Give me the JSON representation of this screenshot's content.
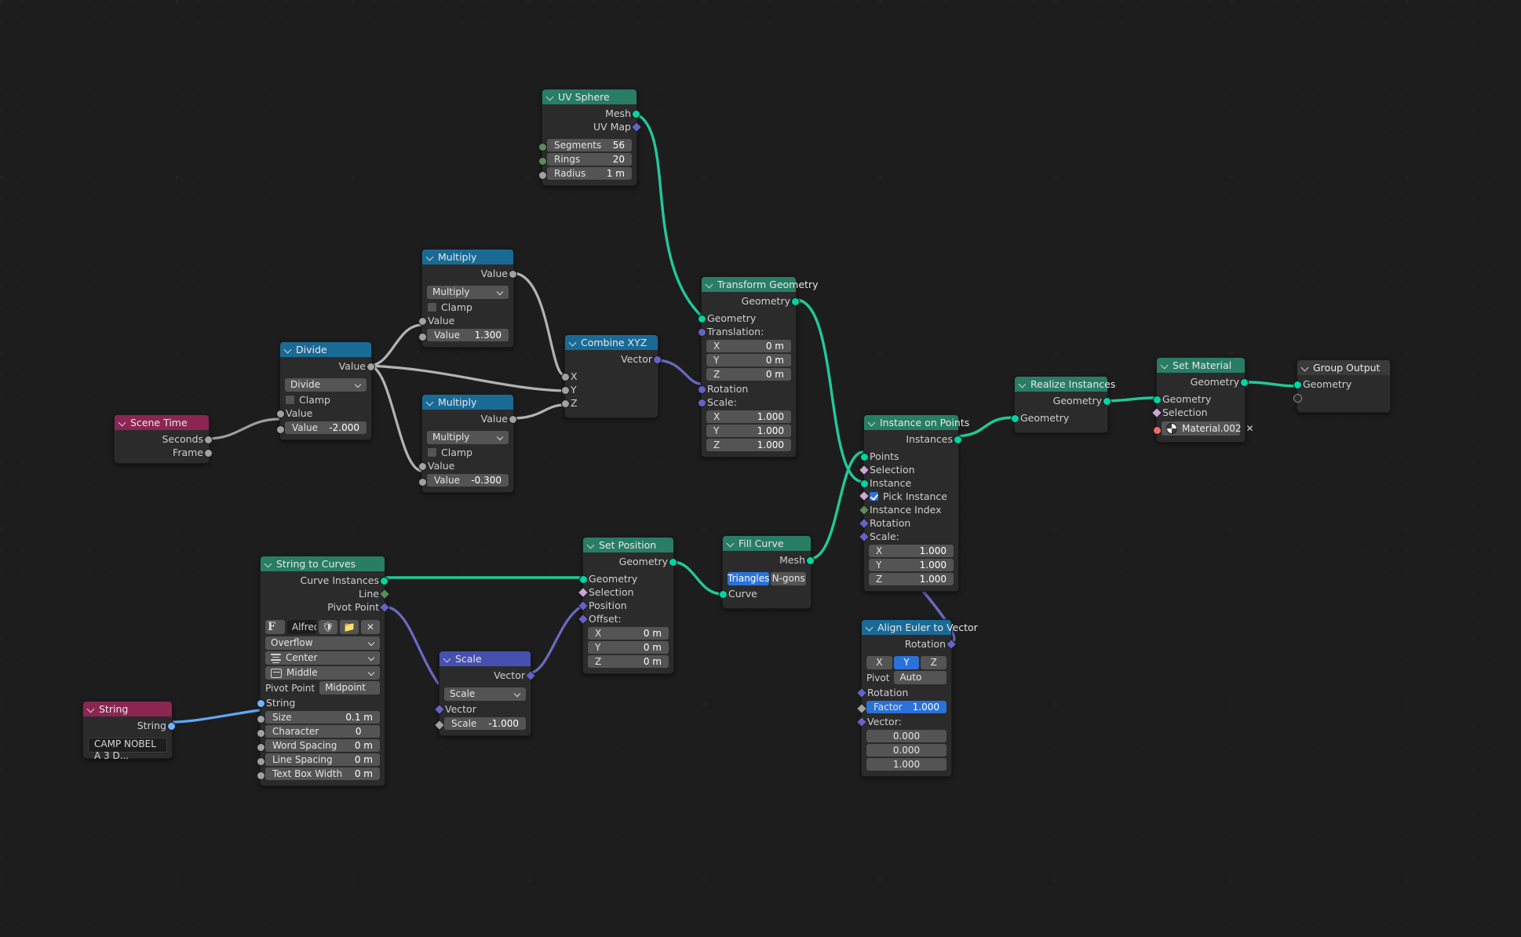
{
  "app": {
    "editor": "Blender Geometry Nodes Editor",
    "background": "#1d1d1d"
  },
  "socket_colors": {
    "geometry": "#00d6a3",
    "vector": "#6363c7",
    "float": "#a1a1a1",
    "integer": "#598c5c",
    "boolean": "#cca6d6",
    "string": "#70b2ff",
    "material": "#ec6a6a"
  },
  "header_colors": {
    "geometry": "#287d63",
    "converter": "#1a6a96",
    "vector": "#4650b0",
    "input": "#8b2653"
  },
  "nodes": {
    "uv_sphere": {
      "title": "UV Sphere",
      "outputs": [
        "Mesh",
        "UV Map"
      ],
      "fields": [
        {
          "label": "Segments",
          "value": "56"
        },
        {
          "label": "Rings",
          "value": "20"
        },
        {
          "label": "Radius",
          "value": "1 m"
        }
      ]
    },
    "multiply_top": {
      "title": "Multiply",
      "output": "Value",
      "operation": "Multiply",
      "clamp_label": "Clamp",
      "clamp_checked": false,
      "input_label": "Value",
      "field": {
        "label": "Value",
        "value": "1.300"
      }
    },
    "multiply_bottom": {
      "title": "Multiply",
      "output": "Value",
      "operation": "Multiply",
      "clamp_label": "Clamp",
      "clamp_checked": false,
      "input_label": "Value",
      "field": {
        "label": "Value",
        "value": "-0.300"
      }
    },
    "divide": {
      "title": "Divide",
      "output": "Value",
      "operation": "Divide",
      "clamp_label": "Clamp",
      "clamp_checked": false,
      "input_label": "Value",
      "field": {
        "label": "Value",
        "value": "-2.000"
      }
    },
    "scene_time": {
      "title": "Scene Time",
      "outputs": [
        "Seconds",
        "Frame"
      ]
    },
    "combine_xyz": {
      "title": "Combine XYZ",
      "output": "Vector",
      "inputs": [
        "X",
        "Y",
        "Z"
      ]
    },
    "transform_geometry": {
      "title": "Transform Geometry",
      "output": "Geometry",
      "input_geometry": "Geometry",
      "translation_label": "Translation:",
      "translation": [
        {
          "label": "X",
          "value": "0 m"
        },
        {
          "label": "Y",
          "value": "0 m"
        },
        {
          "label": "Z",
          "value": "0 m"
        }
      ],
      "rotation_label": "Rotation",
      "scale_label": "Scale:",
      "scale": [
        {
          "label": "X",
          "value": "1.000"
        },
        {
          "label": "Y",
          "value": "1.000"
        },
        {
          "label": "Z",
          "value": "1.000"
        }
      ]
    },
    "instance_on_points": {
      "title": "Instance on Points",
      "output": "Instances",
      "inputs": [
        "Points",
        "Selection",
        "Instance"
      ],
      "pick_instance_label": "Pick Instance",
      "pick_instance_checked": true,
      "instance_index_label": "Instance Index",
      "rotation_label": "Rotation",
      "scale_label": "Scale:",
      "scale": [
        {
          "label": "X",
          "value": "1.000"
        },
        {
          "label": "Y",
          "value": "1.000"
        },
        {
          "label": "Z",
          "value": "1.000"
        }
      ]
    },
    "realize_instances": {
      "title": "Realize Instances",
      "output": "Geometry",
      "input": "Geometry"
    },
    "set_material": {
      "title": "Set Material",
      "output": "Geometry",
      "inputs": [
        "Geometry",
        "Selection"
      ],
      "material": "Material.002",
      "material_clear": "✕"
    },
    "group_output": {
      "title": "Group Output",
      "input": "Geometry"
    },
    "string_to_curves": {
      "title": "String to Curves",
      "outputs": [
        "Curve Instances",
        "Line",
        "Pivot Point"
      ],
      "font_name": "Alfred Sans...",
      "font_glyph": "F",
      "overflow": "Overflow",
      "align_x": "Center",
      "align_y": "Middle",
      "pivot_label": "Pivot Point",
      "pivot_value": "Midpoint",
      "string_label": "String",
      "fields": [
        {
          "label": "Size",
          "value": "0.1 m"
        },
        {
          "label": "Character Spacing",
          "value": "0 m"
        },
        {
          "label": "Word Spacing",
          "value": "0 m"
        },
        {
          "label": "Line Spacing",
          "value": "0 m"
        },
        {
          "label": "Text Box Width",
          "value": "0 m"
        }
      ]
    },
    "string": {
      "title": "String",
      "output": "String",
      "value": "CAMP NOBEL A 3 D..."
    },
    "set_position": {
      "title": "Set Position",
      "output": "Geometry",
      "inputs": [
        "Geometry",
        "Selection",
        "Position"
      ],
      "offset_label": "Offset:",
      "offset": [
        {
          "label": "X",
          "value": "0 m"
        },
        {
          "label": "Y",
          "value": "0 m"
        },
        {
          "label": "Z",
          "value": "0 m"
        }
      ]
    },
    "fill_curve": {
      "title": "Fill Curve",
      "output": "Mesh",
      "modes": [
        "Triangles",
        "N-gons"
      ],
      "mode_selected": "Triangles",
      "input": "Curve"
    },
    "scale": {
      "title": "Scale",
      "output": "Vector",
      "operation": "Scale",
      "input_label": "Vector",
      "field": {
        "label": "Scale",
        "value": "-1.000"
      }
    },
    "align_euler": {
      "title": "Align Euler to Vector",
      "output": "Rotation",
      "axes": [
        "X",
        "Y",
        "Z"
      ],
      "axis_selected": "Y",
      "pivot_label": "Pivot",
      "pivot_value": "Auto",
      "rotation_label": "Rotation",
      "factor": {
        "label": "Factor",
        "value": "1.000"
      },
      "vector_label": "Vector:",
      "vector": [
        "0.000",
        "0.000",
        "1.000"
      ]
    }
  }
}
